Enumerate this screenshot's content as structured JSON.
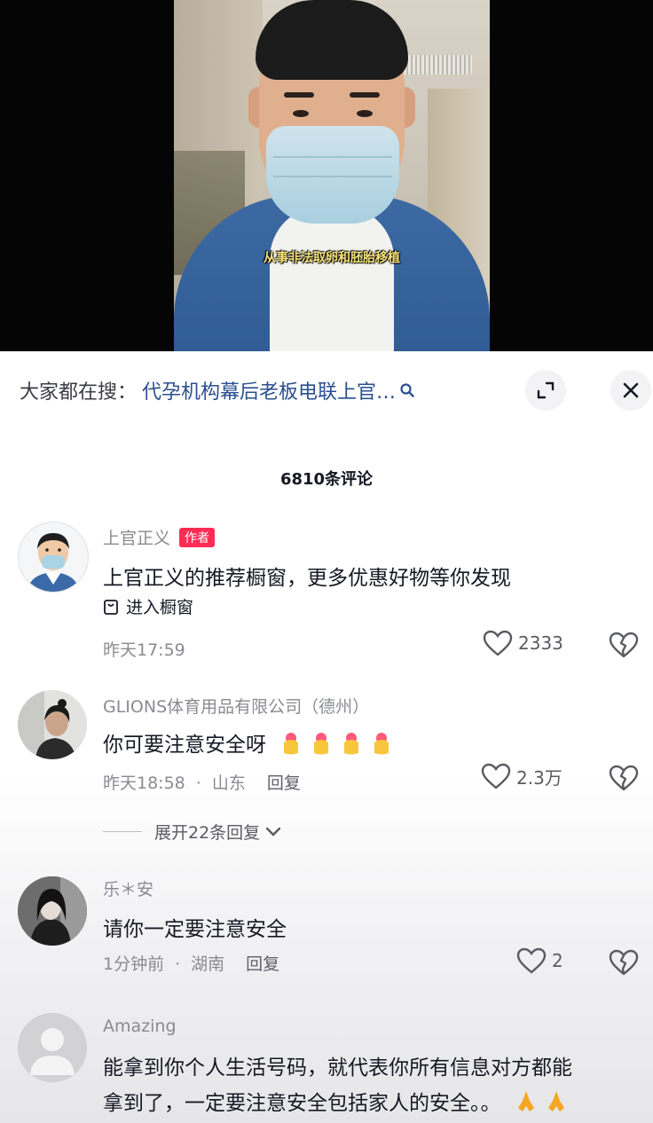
{
  "video": {
    "subtitle": "从事非法取卵和胚胎移植"
  },
  "search": {
    "prefix": "大家都在搜：",
    "query": "代孕机构幕后老板电联上官…",
    "search_icon": "search-icon"
  },
  "panel_controls": {
    "fullscreen_icon": "expand-icon",
    "close_icon": "close-icon"
  },
  "comments_header": {
    "count_label": "6810条评论"
  },
  "comments": [
    {
      "username": "上官正义",
      "badge": "作者",
      "text": "上官正义的推荐橱窗，更多优惠好物等你发现",
      "shop_link": "进入橱窗",
      "time": "昨天17:59",
      "likes": "2333"
    },
    {
      "username": "GLIONS体育用品有限公司（德州）",
      "text": "你可要注意安全呀",
      "emoji_count": 4,
      "time": "昨天18:58",
      "location": "山东",
      "reply": "回复",
      "likes": "2.3万",
      "expand_label": "展开22条回复"
    },
    {
      "username": "乐＊安",
      "text": "请你一定要注意安全",
      "time": "1分钟前",
      "location": "湖南",
      "reply": "回复",
      "likes": "2"
    },
    {
      "username": "Amazing",
      "text_line1": "能拿到你个人生活号码，就代表你所有信息对方都能",
      "text_line2": "拿到了，一定要注意安全包括家人的安全。。"
    }
  ],
  "colors": {
    "author_badge": "#fe2c55",
    "search_query": "#2a4f8f",
    "subtitle": "#f6e27a"
  }
}
